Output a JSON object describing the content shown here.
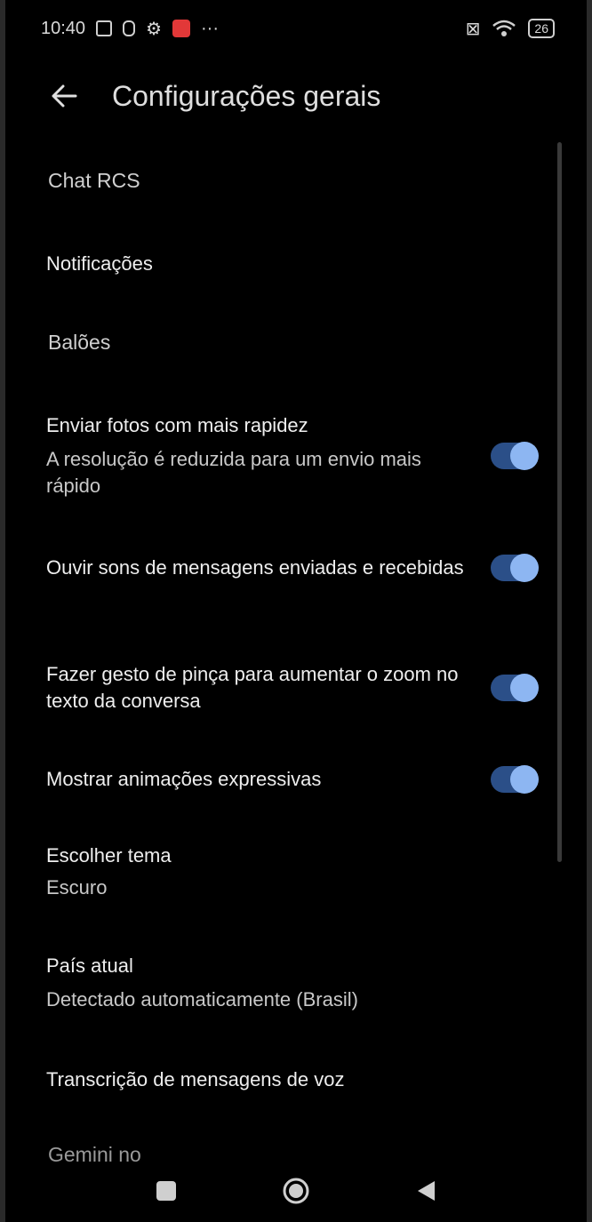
{
  "status_bar": {
    "time": "10:40",
    "battery": "26"
  },
  "header": {
    "title": "Configurações gerais"
  },
  "sections": {
    "chat_rcs": "Chat RCS",
    "baloes": "Balões",
    "gemini_partial": "Gemini no"
  },
  "items": {
    "notificacoes": {
      "title": "Notificações"
    },
    "enviar_fotos": {
      "title": "Enviar fotos com mais rapidez",
      "subtitle": "A resolução é reduzida para um envio mais rápido",
      "enabled": true
    },
    "ouvir_sons": {
      "title": "Ouvir sons de mensagens enviadas e recebidas",
      "enabled": true
    },
    "gesto_pinca": {
      "title": "Fazer gesto de pinça para aumentar o zoom no texto da conversa",
      "enabled": true
    },
    "animacoes": {
      "title": "Mostrar animações expressivas",
      "enabled": true
    },
    "tema": {
      "title": "Escolher tema",
      "subtitle": "Escuro"
    },
    "pais": {
      "title": "País atual",
      "subtitle": "Detectado automaticamente (Brasil)"
    },
    "transcricao": {
      "title": "Transcrição de mensagens de voz"
    }
  },
  "colors": {
    "background": "#000000",
    "switch_track": "#2b4f88",
    "switch_knob": "#8db6f2"
  }
}
